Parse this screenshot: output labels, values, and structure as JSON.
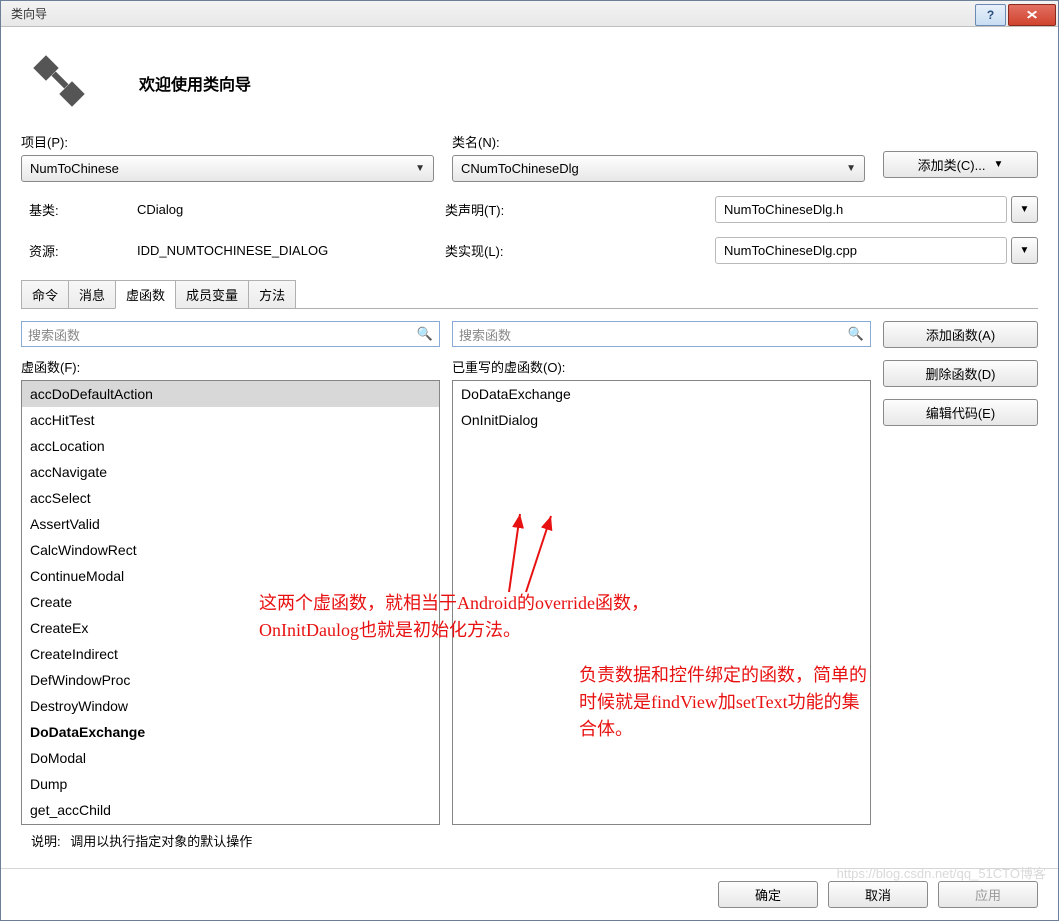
{
  "window": {
    "title": "类向导"
  },
  "header": {
    "title": "欢迎使用类向导"
  },
  "top": {
    "project_label": "项目(P):",
    "project_value": "NumToChinese",
    "class_label": "类名(N):",
    "class_value": "CNumToChineseDlg",
    "add_class_btn": "添加类(C)..."
  },
  "info": {
    "base_label": "基类:",
    "base_value": "CDialog",
    "resource_label": "资源:",
    "resource_value": "IDD_NUMTOCHINESE_DIALOG",
    "decl_label": "类声明(T):",
    "decl_value": "NumToChineseDlg.h",
    "impl_label": "类实现(L):",
    "impl_value": "NumToChineseDlg.cpp"
  },
  "tabs": [
    "命令",
    "消息",
    "虚函数",
    "成员变量",
    "方法"
  ],
  "search": {
    "left_ph": "搜索函数",
    "right_ph": "搜索函数"
  },
  "left_list": {
    "label": "虚函数(F):",
    "items": [
      "accDoDefaultAction",
      "accHitTest",
      "accLocation",
      "accNavigate",
      "accSelect",
      "AssertValid",
      "CalcWindowRect",
      "ContinueModal",
      "Create",
      "CreateEx",
      "CreateIndirect",
      "DefWindowProc",
      "DestroyWindow",
      "DoDataExchange",
      "DoModal",
      "Dump",
      "get_accChild"
    ],
    "selected": 0,
    "bold": [
      13
    ]
  },
  "right_list": {
    "label": "已重写的虚函数(O):",
    "items": [
      "DoDataExchange",
      "OnInitDialog"
    ]
  },
  "buttons": {
    "add_fn": "添加函数(A)",
    "del_fn": "删除函数(D)",
    "edit_code": "编辑代码(E)"
  },
  "description": {
    "label": "说明:",
    "text": "调用以执行指定对象的默认操作"
  },
  "footer": {
    "ok": "确定",
    "cancel": "取消",
    "apply": "应用"
  },
  "annotations": {
    "a1_l1": "这两个虚函数，就相当于Android的override函数，",
    "a1_l2": "OnInitDaulog也就是初始化方法。",
    "a2_l1": "负责数据和控件绑定的函数，简单的",
    "a2_l2": "时候就是findView加setText功能的集",
    "a2_l3": "合体。"
  },
  "watermark": "https://blog.csdn.net/qq_51CTO博客"
}
